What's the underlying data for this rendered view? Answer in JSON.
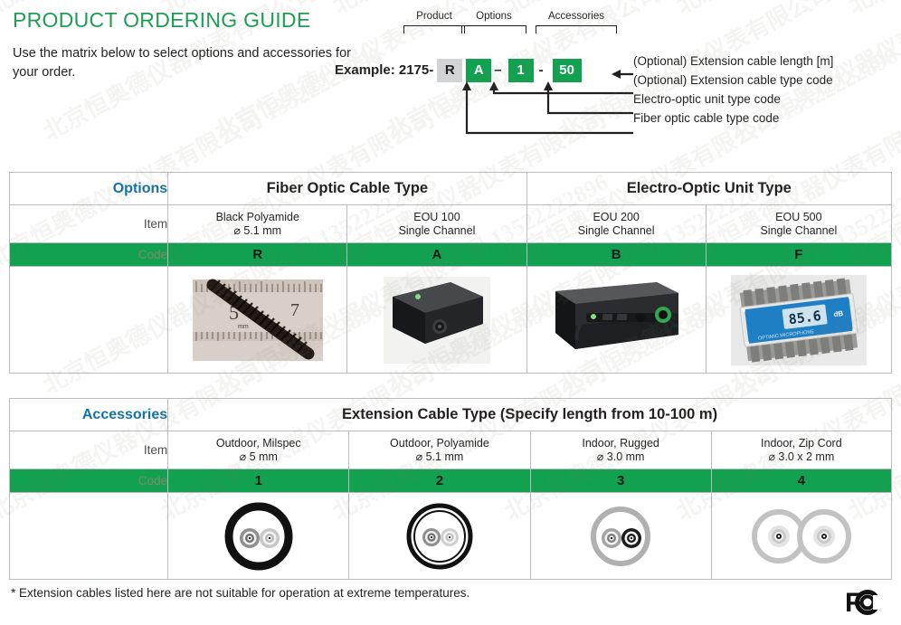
{
  "header": {
    "title": "PRODUCT ORDERING GUIDE",
    "intro": "Use the matrix below to select options and accessories for your order."
  },
  "example": {
    "label": "Example: 2175-",
    "groups": [
      {
        "name": "Product",
        "label": "Product"
      },
      {
        "name": "Options",
        "label": "Options"
      },
      {
        "name": "Accessories",
        "label": "Accessories"
      }
    ],
    "boxes": [
      {
        "name": "fiber-optic-code",
        "value": "R",
        "style": "grey"
      },
      {
        "name": "electro-optic-code",
        "value": "A",
        "style": "green"
      },
      {
        "name": "extension-type-code",
        "value": "1",
        "style": "green"
      },
      {
        "name": "extension-length-code",
        "value": "50",
        "style": "green"
      }
    ],
    "dash": "–",
    "hyphen": "-",
    "annotations": [
      "(Optional) Extension cable length [m]",
      "(Optional) Extension cable type code",
      "Electro-optic unit type code",
      "Fiber optic cable type code"
    ]
  },
  "options_table": {
    "group_label": "Options",
    "headers": [
      {
        "label": "Fiber Optic Cable Type",
        "span": 2
      },
      {
        "label": "Electro-Optic Unit Type",
        "span": 2
      }
    ],
    "row_labels": {
      "item": "Item",
      "code": "Code"
    },
    "items": [
      {
        "line1": "Black Polyamide",
        "line2": "⌀ 5.1 mm",
        "code": "R",
        "image": "cable-on-ruler-photo"
      },
      {
        "line1": "EOU 100",
        "line2": "Single Channel",
        "code": "A",
        "image": "eou-100-photo"
      },
      {
        "line1": "EOU 200",
        "line2": "Single Channel",
        "code": "B",
        "image": "eou-200-photo"
      },
      {
        "line1": "EOU 500",
        "line2": "Single Channel",
        "code": "F",
        "image": "eou-500-photo"
      }
    ],
    "eou500_display": "85.6",
    "eou500_unit": "dB",
    "eou500_caption": "OPTIMIC MICROPHONE"
  },
  "accessories_table": {
    "group_label": "Accessories",
    "header": "Extension Cable Type (Specify length from 10-100 m)",
    "row_labels": {
      "item": "Item",
      "code": "Code"
    },
    "items": [
      {
        "line1": "Outdoor, Milspec",
        "line2": "⌀ 5 mm",
        "code": "1",
        "image": "cable-cross-section-milspec"
      },
      {
        "line1": "Outdoor, Polyamide",
        "line2": "⌀ 5.1 mm",
        "code": "2",
        "image": "cable-cross-section-polyamide"
      },
      {
        "line1": "Indoor, Rugged",
        "line2": "⌀ 3.0 mm",
        "code": "3",
        "image": "cable-cross-section-rugged"
      },
      {
        "line1": "Indoor, Zip Cord",
        "line2": "⌀ 3.0 x 2 mm",
        "code": "4",
        "image": "cable-cross-section-zipcord"
      }
    ]
  },
  "footnote": "* Extension cables listed here are not suitable for operation at extreme temperatures.",
  "fcc_logo": "fcc-logo",
  "colors": {
    "green": "#12a150",
    "title_green": "#1f9d55",
    "accent_blue": "#1273a8",
    "border": "#b9bcbe",
    "grey_box": "#d2d3d5",
    "text": "#231f20"
  },
  "watermark_text": "北京恒奥德仪器仪表有限公司 13522222896"
}
